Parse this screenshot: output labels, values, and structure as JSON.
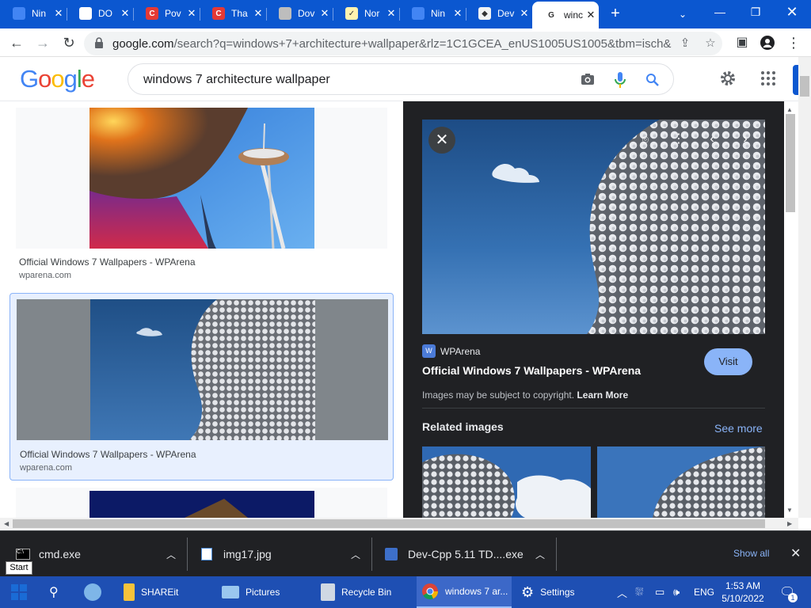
{
  "tabs": [
    {
      "title": "Nin",
      "fav": "",
      "favColor": "#4285f4"
    },
    {
      "title": "DO",
      "fav": "",
      "favColor": "#ffffff"
    },
    {
      "title": "Pov",
      "fav": "C",
      "favColor": "#e53935"
    },
    {
      "title": "Tha",
      "fav": "C",
      "favColor": "#e53935"
    },
    {
      "title": "Dov",
      "fav": "",
      "favColor": "#bdbdbd"
    },
    {
      "title": "Nor",
      "fav": "✓",
      "favColor": "#fff3b0"
    },
    {
      "title": "Nin",
      "fav": "",
      "favColor": "#4285f4"
    },
    {
      "title": "Dev",
      "fav": "◆",
      "favColor": "#f1f3f4"
    },
    {
      "title": "winc",
      "fav": "G",
      "favColor": "#ffffff"
    }
  ],
  "toolbar": {
    "url_host": "google.com",
    "url_rest": "/search?q=windows+7+architecture+wallpaper&rlz=1C1GCEA_enUS1005US1005&tbm=isch&sourc..."
  },
  "search": {
    "logo": [
      "G",
      "o",
      "o",
      "g",
      "l",
      "e"
    ],
    "query": "windows 7 architecture wallpaper"
  },
  "results": [
    {
      "title": "Official Windows 7 Wallpapers - WPArena",
      "source": "wparena.com"
    },
    {
      "title": "Official Windows 7 Wallpapers - WPArena",
      "source": "wparena.com"
    }
  ],
  "panel": {
    "source_name": "WPArena",
    "title": "Official Windows 7 Wallpapers - WPArena",
    "visit_label": "Visit",
    "copyright": "Images may be subject to copyright.",
    "learn_more": "Learn More",
    "related_heading": "Related images",
    "see_more": "See more"
  },
  "downloads": {
    "items": [
      {
        "name": "cmd.exe"
      },
      {
        "name": "img17.jpg"
      },
      {
        "name": "Dev-Cpp 5.11 TD....exe"
      }
    ],
    "show_all": "Show all"
  },
  "taskbar": {
    "start_tooltip": "Start",
    "apps": [
      {
        "label": "SHAREit"
      },
      {
        "label": "Pictures"
      },
      {
        "label": "Recycle Bin"
      },
      {
        "label": "windows 7 ar..."
      },
      {
        "label": "Settings"
      }
    ],
    "lang": "ENG",
    "time": "1:53 AM",
    "date": "5/10/2022",
    "notif_count": "1"
  },
  "colors": {
    "accent": "#0b57d0",
    "panel_bg": "#202124",
    "visit_bg": "#8ab4f8",
    "link_blue": "#8ab4f8",
    "taskbar": "#1e4fb3"
  }
}
